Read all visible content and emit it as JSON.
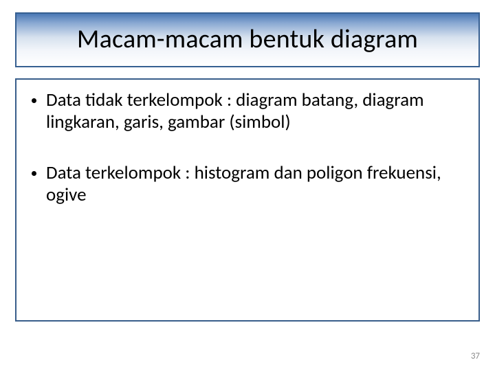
{
  "slide": {
    "title": "Macam-macam bentuk diagram",
    "bullets": [
      "Data tidak terkelompok : diagram batang, diagram lingkaran, garis, gambar (simbol)",
      "Data terkelompok : histogram dan poligon frekuensi, ogive"
    ],
    "page_number": "37"
  }
}
